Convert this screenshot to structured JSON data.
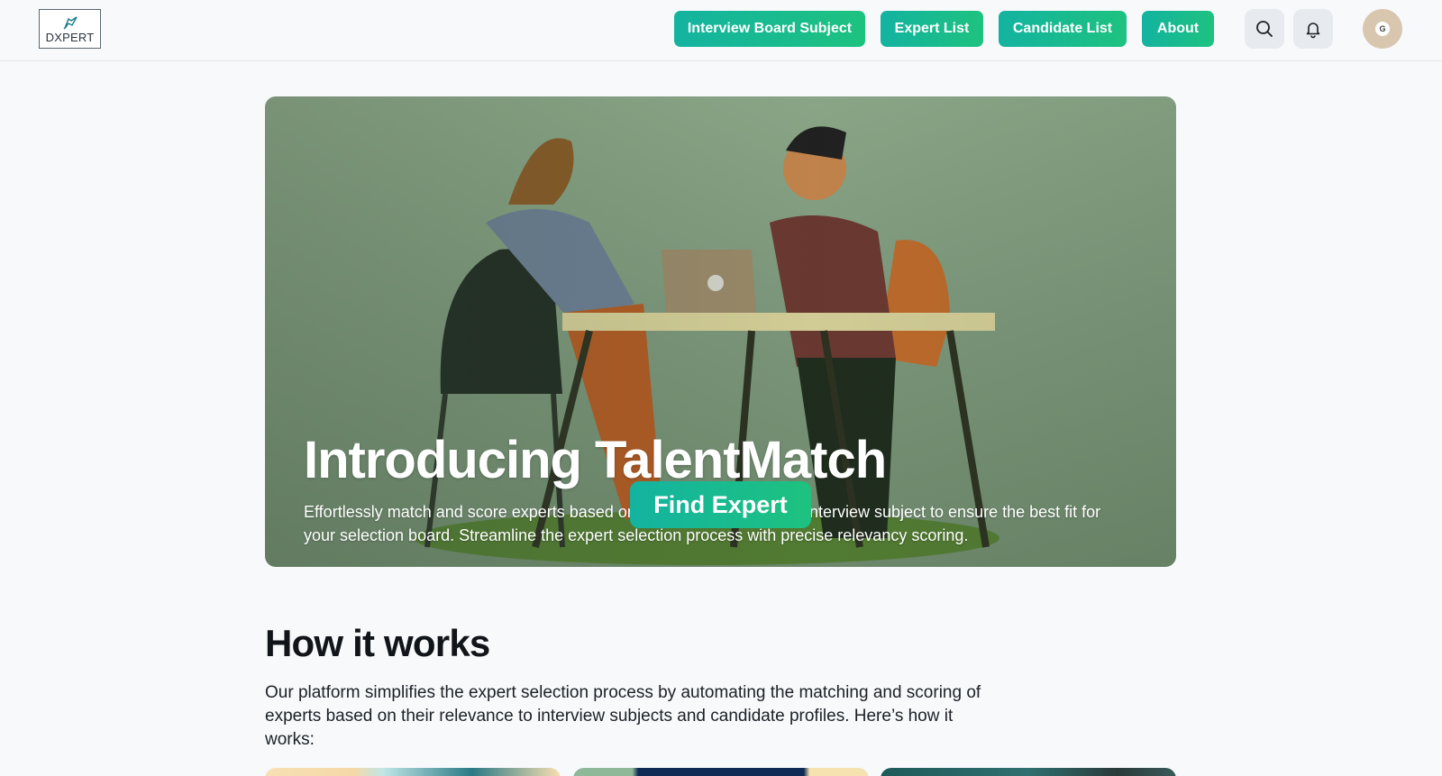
{
  "header": {
    "logo_text": "DXPERT",
    "nav": [
      {
        "label": "Interview Board Subject"
      },
      {
        "label": "Expert List"
      },
      {
        "label": "Candidate List"
      },
      {
        "label": "About"
      }
    ],
    "avatar_initial": "G"
  },
  "hero": {
    "title": "Introducing TalentMatch",
    "description": "Effortlessly match and score experts based on their expertise and the interview subject to ensure the best fit for your selection board. Streamline the expert selection process with precise relevancy scoring.",
    "cta_label": "Find Expert"
  },
  "how_it_works": {
    "title": "How it works",
    "description": "Our platform simplifies the expert selection process by automating the matching and scoring of experts based on their relevance to interview subjects and candidate profiles. Here’s how it works:"
  },
  "colors": {
    "accent_start": "#13b3a0",
    "accent_end": "#1ec27f",
    "background": "#f7f9fb"
  }
}
